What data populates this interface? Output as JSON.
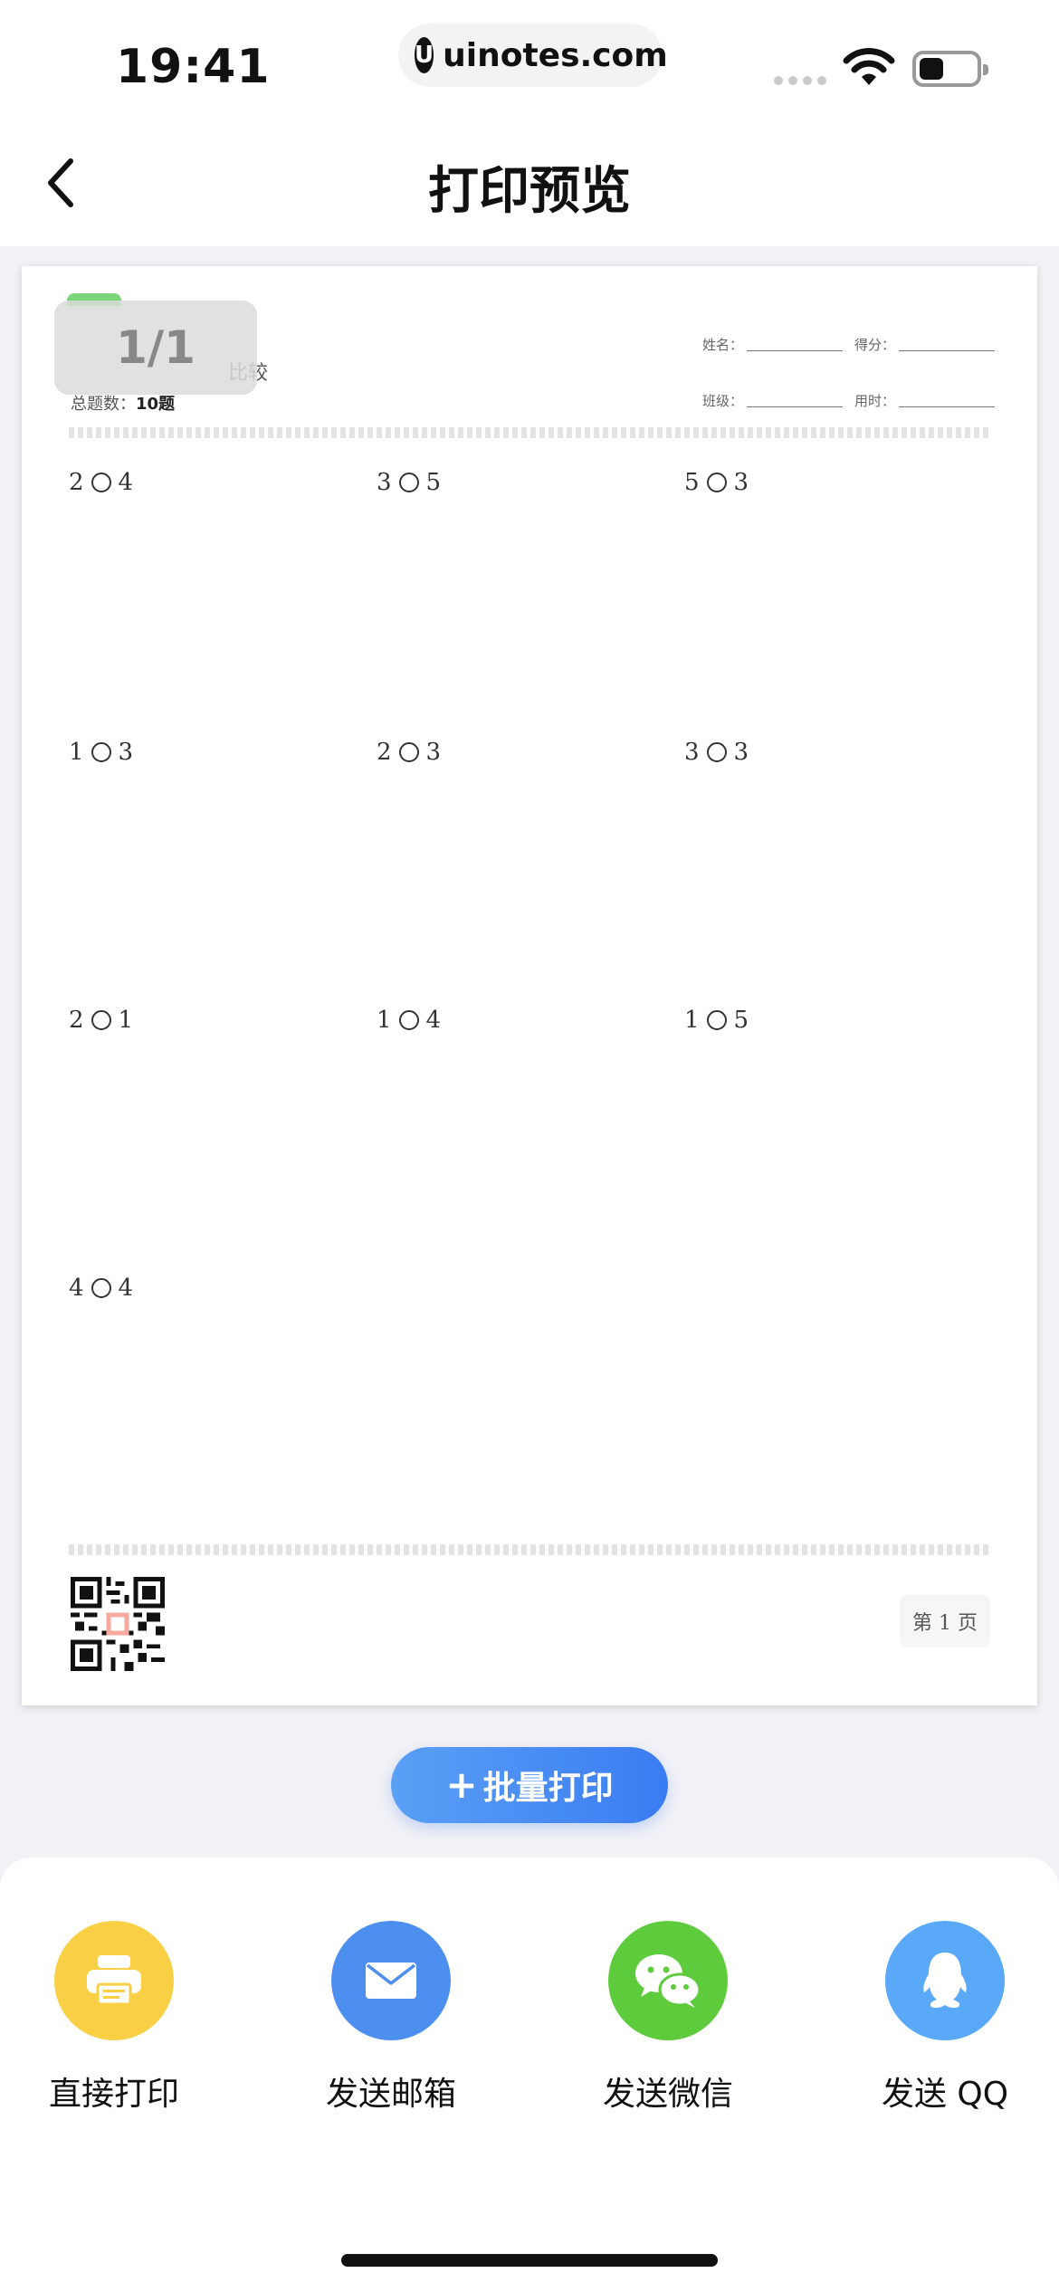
{
  "status": {
    "time": "19:41",
    "url": "uinotes.com"
  },
  "nav": {
    "title": "打印预览"
  },
  "preview": {
    "page_indicator": "1/1",
    "title_fragment": "比较",
    "total_label": "总题数：",
    "total_value": "10题",
    "fields": {
      "name": "姓名：",
      "score": "得分：",
      "class": "班级：",
      "time": "用时："
    },
    "questions": [
      {
        "a": "2",
        "b": "4"
      },
      {
        "a": "3",
        "b": "5"
      },
      {
        "a": "5",
        "b": "3"
      },
      {
        "a": "1",
        "b": "3"
      },
      {
        "a": "2",
        "b": "3"
      },
      {
        "a": "3",
        "b": "3"
      },
      {
        "a": "2",
        "b": "1"
      },
      {
        "a": "1",
        "b": "4"
      },
      {
        "a": "1",
        "b": "5"
      },
      {
        "a": "4",
        "b": "4"
      }
    ],
    "page_label": "第 1 页"
  },
  "batch_print": {
    "plus": "+",
    "label": "批量打印"
  },
  "actions": [
    {
      "icon": "printer-icon",
      "label": "直接打印",
      "color": "#F9CF45"
    },
    {
      "icon": "mail-icon",
      "label": "发送邮箱",
      "color": "#4D8FEF"
    },
    {
      "icon": "wechat-icon",
      "label": "发送微信",
      "color": "#5DCB3B"
    },
    {
      "icon": "qq-icon",
      "label": "发送 QQ",
      "color": "#5AA8F8"
    }
  ]
}
